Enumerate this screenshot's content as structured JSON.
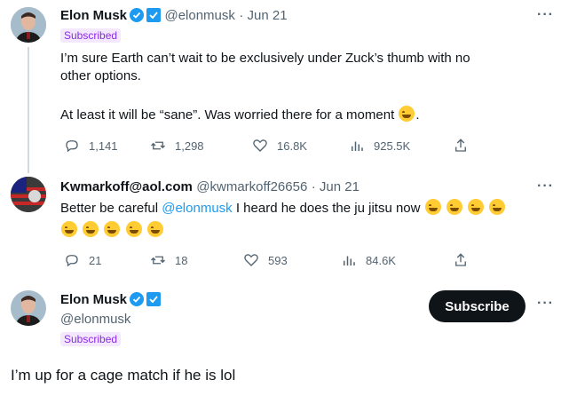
{
  "tweet1": {
    "name": "Elon Musk",
    "handle": "@elonmusk",
    "date": "· Jun 21",
    "subscribed": "Subscribed",
    "line1": "I’m sure Earth can’t wait to be exclusively under Zuck’s thumb with no",
    "line2": "other options.",
    "line3": "At least it will be “sane”. Was worried there for a moment",
    "line3_end": ".",
    "replies": "1,141",
    "retweets": "1,298",
    "likes": "16.8K",
    "views": "925.5K"
  },
  "tweet2": {
    "name": "Kwmarkoff@aol.com",
    "handle": "@kwmarkoff26656",
    "date": "· Jun 21",
    "text_before": "Better be careful",
    "mention": "@elonmusk",
    "text_after": "I heard he does the ju jitsu now",
    "replies": "21",
    "retweets": "18",
    "likes": "593",
    "views": "84.6K"
  },
  "tweet3": {
    "name": "Elon Musk",
    "handle": "@elonmusk",
    "subscribed": "Subscribed",
    "subscribe_button": "Subscribe",
    "text": "I’m up for a cage match if he is lol"
  },
  "more_label": "···",
  "colors": {
    "verified_blue": "#1d9bf0",
    "gold_badge": "#1d9bf0",
    "subscribed_bg": "#f4e8ff",
    "subscribed_text": "#8a2be2",
    "link": "#1d9bf0"
  }
}
